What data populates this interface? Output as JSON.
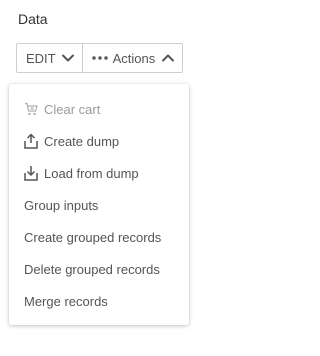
{
  "section": {
    "title": "Data"
  },
  "toolbar": {
    "edit_label": "EDIT",
    "edit_icon": "chevron-down-icon",
    "actions_label": "Actions",
    "actions_icon": "more-horizontal-icon",
    "actions_toggle_icon": "chevron-up-icon"
  },
  "menu": {
    "items": [
      {
        "label": "Clear cart",
        "icon": "cart-clear-icon",
        "disabled": true
      },
      {
        "label": "Create dump",
        "icon": "upload-icon",
        "disabled": false
      },
      {
        "label": "Load from dump",
        "icon": "download-icon",
        "disabled": false
      },
      {
        "label": "Group inputs",
        "icon": "",
        "disabled": false
      },
      {
        "label": "Create grouped records",
        "icon": "",
        "disabled": false
      },
      {
        "label": "Delete grouped records",
        "icon": "",
        "disabled": false
      },
      {
        "label": "Merge records",
        "icon": "",
        "disabled": false
      }
    ]
  },
  "colors": {
    "text": "#555555",
    "title": "#333333",
    "disabled": "#9a9a9a",
    "border": "#cfcfcf",
    "background": "#ffffff"
  }
}
